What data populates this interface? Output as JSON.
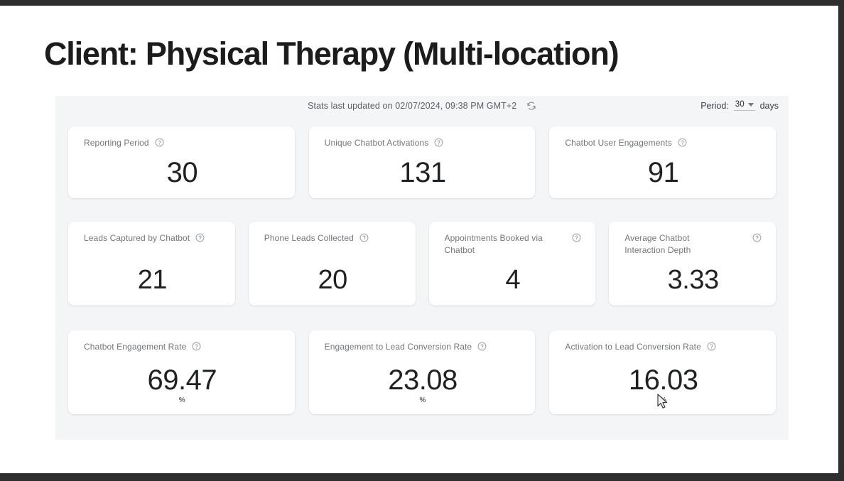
{
  "page": {
    "title": "Client: Physical Therapy (Multi-location)"
  },
  "topbar": {
    "stats_updated": "Stats last updated on 02/07/2024, 09:38 PM GMT+2",
    "refresh_icon": "refresh-icon",
    "period_prefix": "Period:",
    "period_value": "30",
    "period_suffix": "days"
  },
  "cards": {
    "row1": [
      {
        "label": "Reporting Period",
        "value": "30",
        "unit": "",
        "help_icon": "help-circle-icon",
        "name": "reporting-period"
      },
      {
        "label": "Unique Chatbot Activations",
        "value": "131",
        "unit": "",
        "help_icon": "help-circle-icon",
        "name": "unique-chatbot-activations"
      },
      {
        "label": "Chatbot User Engagements",
        "value": "91",
        "unit": "",
        "help_icon": "help-circle-icon",
        "name": "chatbot-user-engagements"
      }
    ],
    "row2": [
      {
        "label": "Leads Captured by Chatbot",
        "value": "21",
        "unit": "",
        "help_icon": "help-circle-icon",
        "name": "leads-captured-by-chatbot"
      },
      {
        "label": "Phone Leads Collected",
        "value": "20",
        "unit": "",
        "help_icon": "help-circle-icon",
        "name": "phone-leads-collected"
      },
      {
        "label": "Appointments Booked via Chatbot",
        "value": "4",
        "unit": "",
        "help_icon": "help-circle-icon",
        "name": "appointments-booked-via-chatbot"
      },
      {
        "label": "Average Chatbot Interaction Depth",
        "value": "3.33",
        "unit": "",
        "help_icon": "help-circle-icon",
        "name": "average-chatbot-interaction-depth"
      }
    ],
    "row3": [
      {
        "label": "Chatbot Engagement Rate",
        "value": "69.47",
        "unit": "%",
        "help_icon": "help-circle-icon",
        "name": "chatbot-engagement-rate"
      },
      {
        "label": "Engagement to Lead Conversion Rate",
        "value": "23.08",
        "unit": "%",
        "help_icon": "help-circle-icon",
        "name": "engagement-to-lead-conversion-rate"
      },
      {
        "label": "Activation to Lead Conversion Rate",
        "value": "16.03",
        "unit": "%",
        "help_icon": "help-circle-icon",
        "name": "activation-to-lead-conversion-rate"
      }
    ]
  },
  "colors": {
    "page_background": "#ffffff",
    "panel_background": "#f4f5f7",
    "card_background": "#ffffff",
    "title_text": "#1c1c1c",
    "label_text": "#73767a",
    "value_text": "#1f2123",
    "frame": "#2e2e2e"
  }
}
